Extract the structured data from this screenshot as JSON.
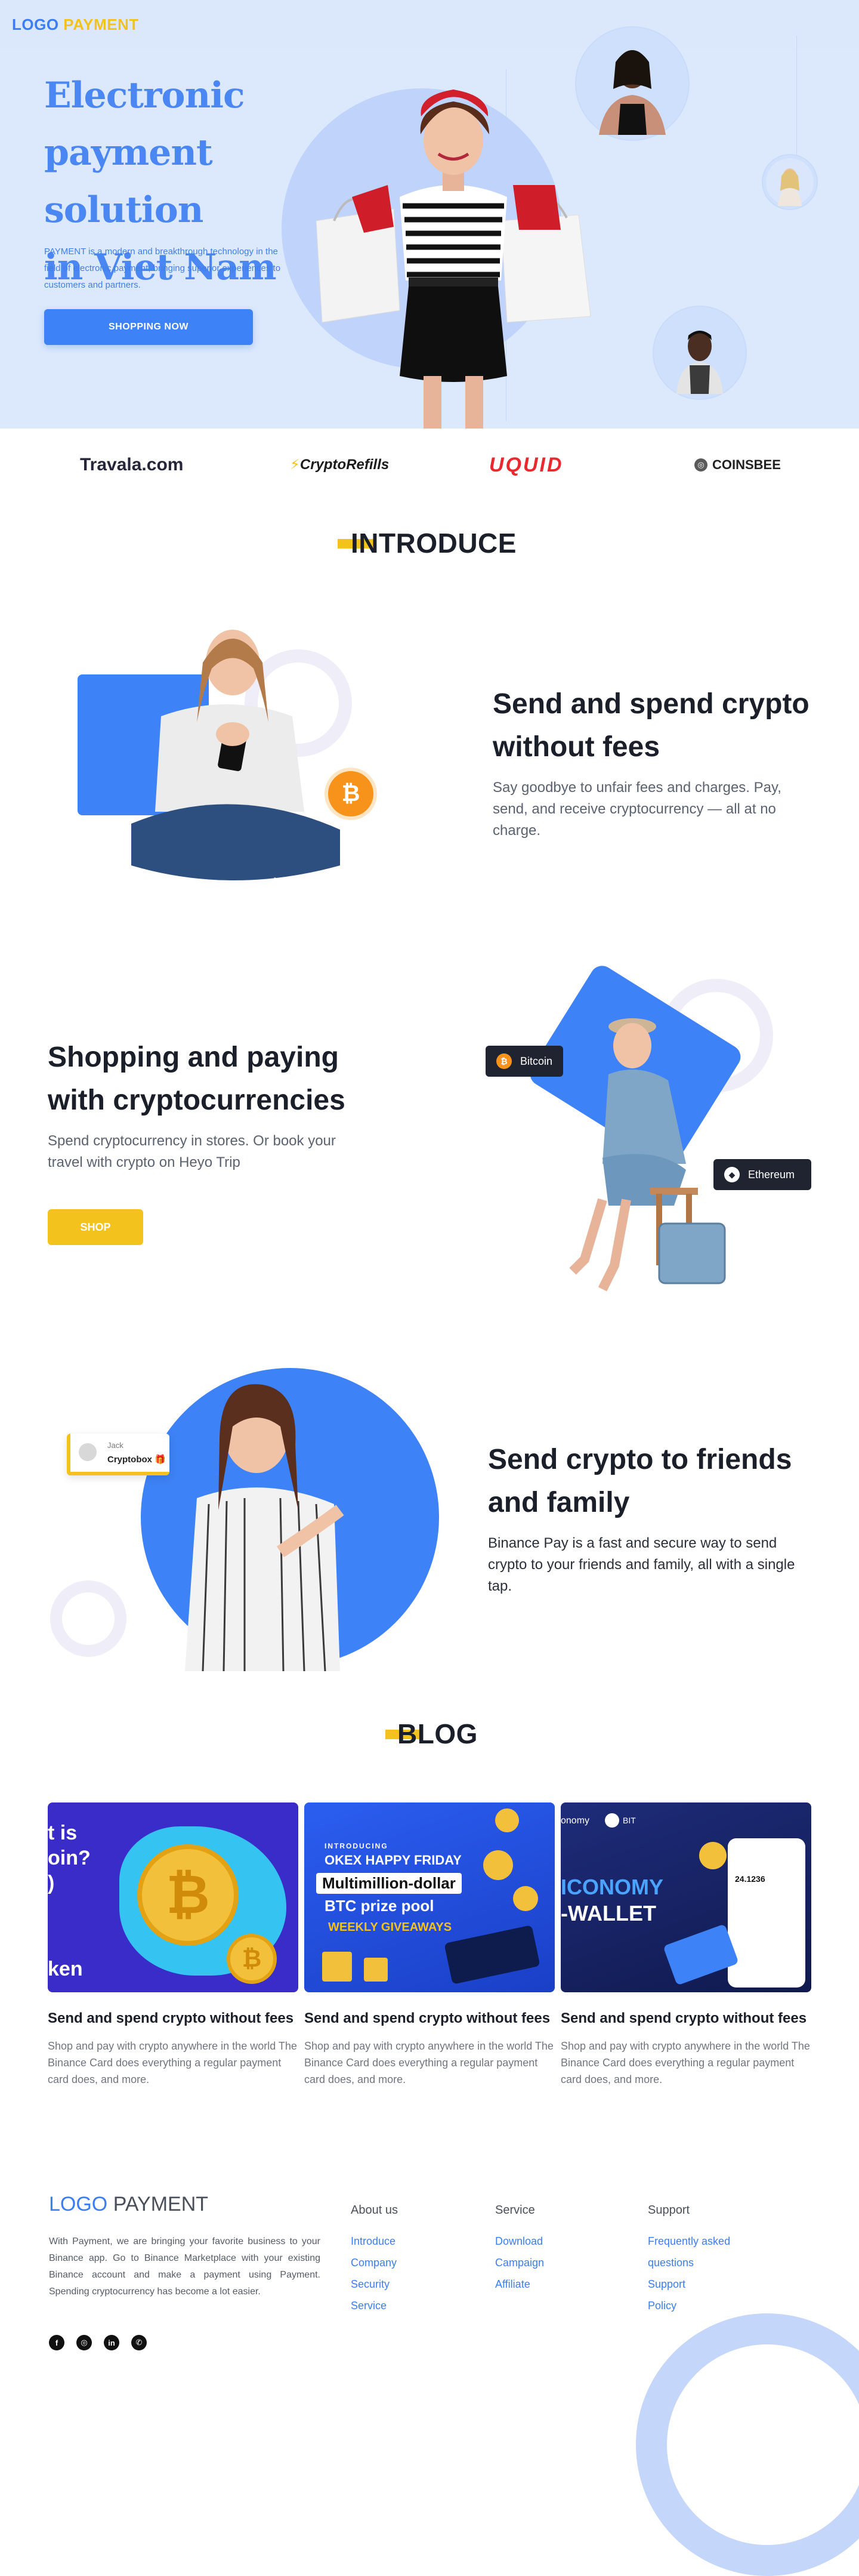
{
  "brand": {
    "logo_word": "LOGO",
    "logo_word2": "PAYMENT"
  },
  "hero": {
    "title_line1": "Electronic",
    "title_line2": "payment solution",
    "title_line3": "in Viet Nam",
    "description": "PAYMENT is a modern and breakthrough technology in the field of electronic payment, bringing superior experiences to customers and partners.",
    "cta_label": "SHOPPING NOW"
  },
  "partners": [
    "Travala.com",
    "CryptoRefills",
    "UQUID",
    "COINSBEE"
  ],
  "introduce": {
    "title": "INTRODUCE",
    "features": [
      {
        "title_line1": "Send and spend crypto",
        "title_line2": "without fees",
        "description": "Say goodbye to unfair fees and charges. Pay, send, and receive cryptocurrency — all at no charge."
      },
      {
        "title_line1": "Shopping and paying",
        "title_line2": "with cryptocurrencies",
        "description": "Spend cryptocurrency in stores. Or book your travel with crypto on Heyo Trip",
        "button_label": "SHOP",
        "tag1": "Bitcoin",
        "tag2": "Ethereum"
      },
      {
        "title_line1": "Send crypto to friends",
        "title_line2": "and family",
        "description": "Binance Pay is a fast and secure way to send crypto to your friends and family, all with a single tap.",
        "chat_name": "Jack",
        "chat_message": "Cryptobox"
      }
    ]
  },
  "blog": {
    "title": "BLOG",
    "posts": [
      {
        "title": "Send and spend crypto without fees",
        "description": "Shop and pay with crypto anywhere in the world The Binance Card does everything a regular payment card does, and more.",
        "image_text": [
          "t is",
          "oin?",
          ")",
          "ken"
        ]
      },
      {
        "title": "Send and spend crypto without fees",
        "description": "Shop and pay with crypto anywhere in the world The Binance Card does everything a regular payment card does, and more.",
        "image_text": [
          "INTRODUCING",
          "OKEX HAPPY FRIDAY",
          "Multimillion-dollar",
          "BTC prize pool",
          "WEEKLY GIVEAWAYS"
        ]
      },
      {
        "title": "Send and spend crypto without fees",
        "description": "Shop and pay with crypto anywhere in the world The Binance Card does everything a regular payment card does, and more.",
        "image_text": [
          "onomy",
          "BIT",
          "ICONOMY",
          "-WALLET",
          "24.1236"
        ]
      }
    ]
  },
  "footer": {
    "about": "With Payment, we are bringing your favorite business to your Binance app. Go to Binance Marketplace with your existing Binance account and make a payment using Payment. Spending cryptocurrency has become a lot easier.",
    "columns": [
      {
        "heading": "About us",
        "links": [
          "Introduce",
          "Company",
          "Security",
          "Service"
        ]
      },
      {
        "heading": "Service",
        "links": [
          "Download",
          "Campaign",
          "Affiliate"
        ]
      },
      {
        "heading": "Support",
        "links": [
          "Frequently asked",
          "questions",
          "Support",
          "Policy"
        ]
      }
    ],
    "social_icons": [
      "facebook-icon",
      "instagram-icon",
      "linkedin-icon",
      "whatsapp-icon"
    ]
  }
}
